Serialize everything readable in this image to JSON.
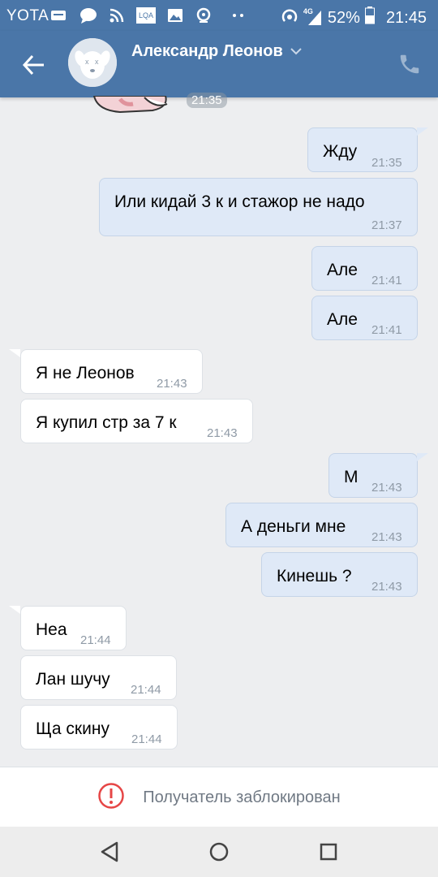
{
  "status_bar": {
    "carrier": "YOTA",
    "network": "4G",
    "battery": "52%",
    "time": "21:45",
    "icons": [
      "sms-icon",
      "chat-icon",
      "rss-icon",
      "app-icon",
      "image-icon",
      "lastpass-icon",
      "more-icon",
      "hotspot-icon",
      "signal-icon",
      "battery-icon"
    ]
  },
  "header": {
    "contact_name": "Александр Леонов",
    "back_icon": "arrow-left-icon",
    "dropdown_icon": "chevron-down-icon",
    "call_icon": "phone-icon"
  },
  "sticker": {
    "time": "21:35"
  },
  "messages": [
    {
      "dir": "out",
      "text": "Жду",
      "time": "21:35"
    },
    {
      "dir": "out",
      "text": "Или кидай 3 к и стажор не надо",
      "time": "21:37"
    },
    {
      "dir": "out",
      "text": "Але",
      "time": "21:41"
    },
    {
      "dir": "out",
      "text": "Але",
      "time": "21:41"
    },
    {
      "dir": "in",
      "text": "Я не Леонов",
      "time": "21:43"
    },
    {
      "dir": "in",
      "text": "Я купил стр за 7 к",
      "time": "21:43"
    },
    {
      "dir": "out",
      "text": "М",
      "time": "21:43"
    },
    {
      "dir": "out",
      "text": "А деньги мне",
      "time": "21:43"
    },
    {
      "dir": "out",
      "text": "Кинешь ?",
      "time": "21:43"
    },
    {
      "dir": "in",
      "text": "Неа",
      "time": "21:44"
    },
    {
      "dir": "in",
      "text": "Лан шучу",
      "time": "21:44"
    },
    {
      "dir": "in",
      "text": "Ща скину",
      "time": "21:44"
    }
  ],
  "blocked_bar": {
    "text": "Получатель заблокирован",
    "icon": "alert-circle-icon"
  },
  "nav_bar": {
    "buttons": [
      "back-triangle-icon",
      "home-circle-icon",
      "recents-square-icon"
    ]
  },
  "colors": {
    "header": "#4a76a8",
    "outgoing_bubble": "#dfe9f7",
    "incoming_bubble": "#ffffff",
    "background": "#edeef0",
    "alert": "#e64646"
  }
}
